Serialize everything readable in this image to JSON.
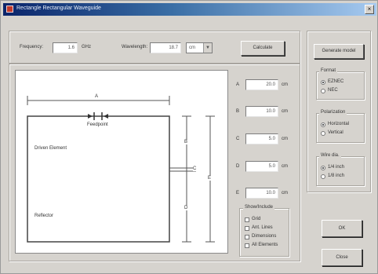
{
  "window": {
    "title": "Rectangle Rectangular Waveguide"
  },
  "top": {
    "frequency_label": "Frequency:",
    "frequency_value": "1.6",
    "frequency_unit": "GHz",
    "wavelength_label": "Wavelength:",
    "wavelength_value": "18.7",
    "wavelength_unit": "cm",
    "calculate_button": "Calculate"
  },
  "dims": [
    {
      "label": "A",
      "value": "20.0"
    },
    {
      "label": "B",
      "value": "10.0"
    },
    {
      "label": "C",
      "value": "5.0"
    },
    {
      "label": "D",
      "value": "5.0"
    },
    {
      "label": "E",
      "value": "10.0"
    }
  ],
  "dims_unit": "cm",
  "diagram": {
    "label_a": "A",
    "label_b": "B",
    "label_c": "C",
    "label_d": "D",
    "label_e": "E",
    "feedpoint": "Feedpoint",
    "driven_element": "Driven Element",
    "reflector": "Reflector"
  },
  "right": {
    "generate_button": "Generate model",
    "format_title": "Format",
    "format_options": [
      "EZNEC",
      "NEC"
    ],
    "polarization_title": "Polarization",
    "polarization_options": [
      "Horizontal",
      "Vertical"
    ],
    "wire_dia_title": "Wire dia.",
    "wire_dia_options": [
      "1/4 inch",
      "1/8 inch"
    ],
    "ok_button": "OK",
    "close_button": "Close"
  },
  "show_guides": {
    "title": "Show/Include",
    "options": [
      "Grid",
      "Ant. Lines",
      "Dimensions",
      "All Elements"
    ]
  }
}
